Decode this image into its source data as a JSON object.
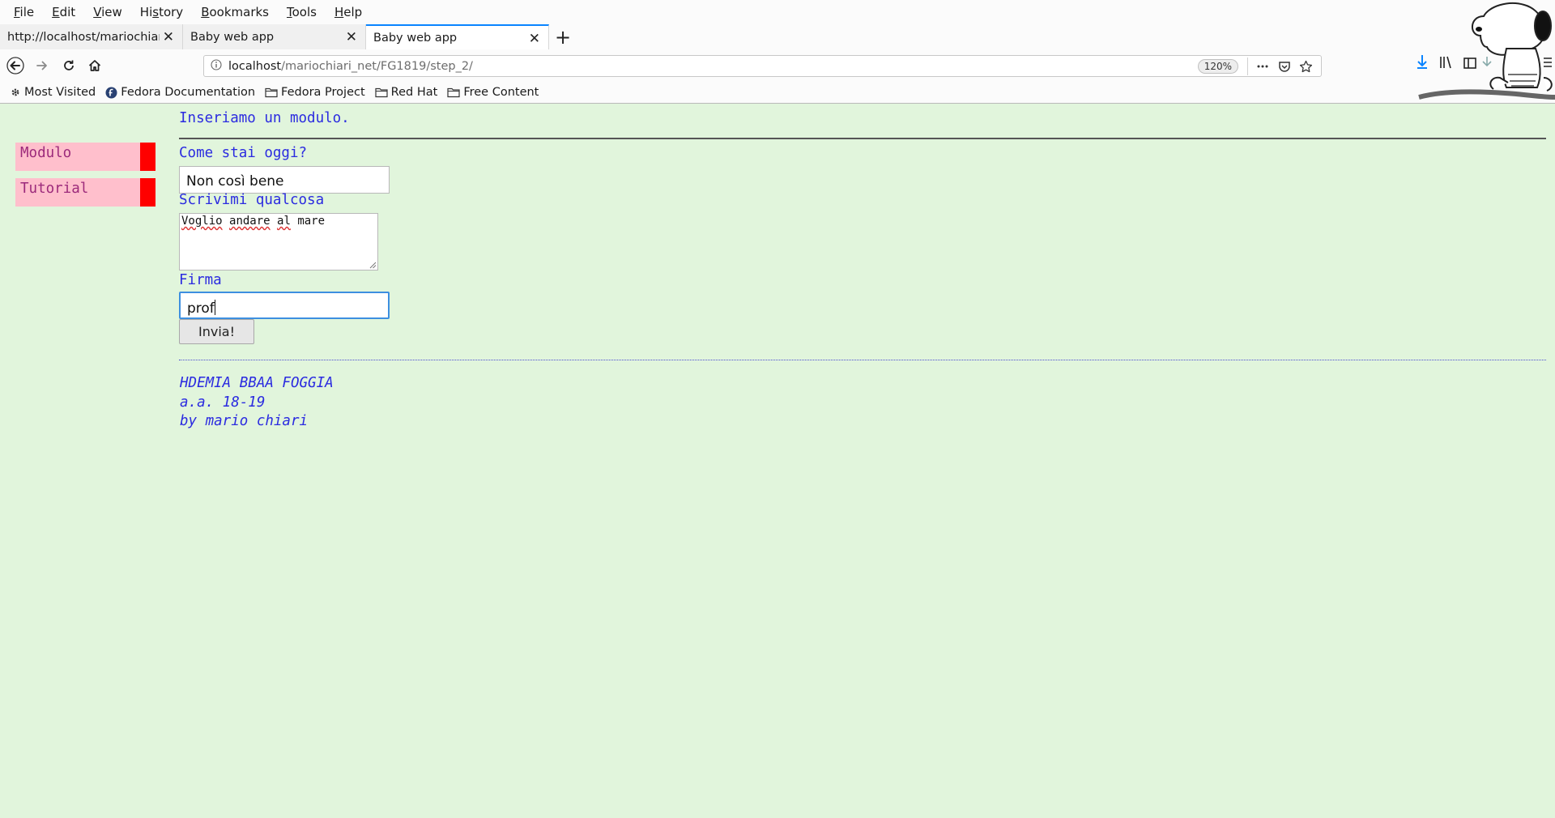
{
  "menubar": [
    {
      "accel": "F",
      "rest": "ile"
    },
    {
      "accel": "E",
      "rest": "dit"
    },
    {
      "accel": "V",
      "rest": "iew"
    },
    {
      "pre": "Hi",
      "accel": "s",
      "rest": "tory"
    },
    {
      "accel": "B",
      "rest": "ookmarks"
    },
    {
      "accel": "T",
      "rest": "ools"
    },
    {
      "accel": "H",
      "rest": "elp"
    }
  ],
  "tabs": [
    {
      "title": "http://localhost/mariochiari_",
      "active": false
    },
    {
      "title": "Baby web app",
      "active": false
    },
    {
      "title": "Baby web app",
      "active": true
    }
  ],
  "tab_close_glyph": "✕",
  "new_tab_glyph": "+",
  "urlbar": {
    "host": "localhost",
    "path": "/mariochiari_net/FG1819/step_2/",
    "zoom": "120%"
  },
  "bookmarks": [
    {
      "label": "Most Visited",
      "icon": "gear-icon"
    },
    {
      "label": "Fedora Documentation",
      "icon": "fedora-icon"
    },
    {
      "label": "Fedora Project",
      "icon": "folder-icon"
    },
    {
      "label": "Red Hat",
      "icon": "folder-icon"
    },
    {
      "label": "Free Content",
      "icon": "folder-icon"
    }
  ],
  "sidebar": {
    "items": [
      {
        "label": "Modulo"
      },
      {
        "label": "Tutorial"
      }
    ]
  },
  "main": {
    "intro": "Inseriamo un modulo.",
    "form": {
      "q1_label": "Come stai oggi?",
      "q1_value": "Non così bene",
      "q2_label": "Scrivimi qualcosa",
      "q2_words": [
        "Voglio",
        "andare",
        "al",
        "mare"
      ],
      "firma_label": "Firma",
      "firma_value": "prof",
      "submit_label": "Invia!"
    },
    "footer": {
      "line1": "HDEMIA BBAA FOGGIA",
      "line2": "a.a. 18-19",
      "line3": "by mario chiari"
    }
  },
  "colors": {
    "page_background": "#e1f5dc",
    "text_blue": "#2b2be0",
    "sidebar_pink": "#ffbfcc",
    "sidebar_red": "#ff0000",
    "accent": "#0a84ff"
  }
}
